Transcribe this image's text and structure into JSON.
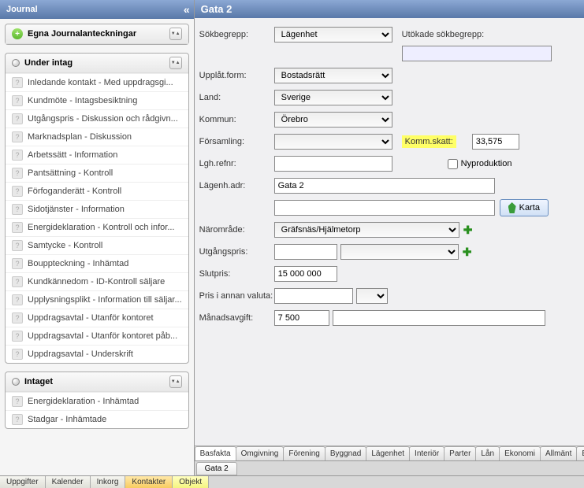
{
  "sidebar": {
    "title": "Journal",
    "sections": [
      {
        "icon": "plus",
        "title": "Egna Journalanteckningar",
        "items": []
      },
      {
        "icon": "bullet",
        "title": "Under intag",
        "items": [
          "Inledande kontakt - Med uppdragsgi...",
          "Kundmöte - Intagsbesiktning",
          "Utgångspris - Diskussion och rådgivn...",
          "Marknadsplan - Diskussion",
          "Arbetssätt - Information",
          "Pantsättning - Kontroll",
          "Förfoganderätt - Kontroll",
          "Sidotjänster - Information",
          "Energideklaration - Kontroll och infor...",
          "Samtycke - Kontroll",
          "Bouppteckning - Inhämtad",
          "Kundkännedom - ID-Kontroll säljare",
          "Upplysningsplikt - Information till säljar...",
          "Uppdragsavtal - Utanför kontoret",
          "Uppdragsavtal - Utanför kontoret påb...",
          "Uppdragsavtal - Underskrift"
        ]
      },
      {
        "icon": "bullet",
        "title": "Intaget",
        "items": [
          "Energideklaration - Inhämtad",
          "Stadgar - Inhämtade"
        ]
      }
    ]
  },
  "content": {
    "title": "Gata 2",
    "form": {
      "sokbegrepp": {
        "label": "Sökbegrepp:",
        "value": "Lägenhet",
        "extra_label": "Utökade sökbegrepp:"
      },
      "upplatform": {
        "label": "Upplåt.form:",
        "value": "Bostadsrätt"
      },
      "land": {
        "label": "Land:",
        "value": "Sverige"
      },
      "kommun": {
        "label": "Kommun:",
        "value": "Örebro"
      },
      "forsamling": {
        "label": "Församling:",
        "value": "",
        "skatt_label": "Komm.skatt:",
        "skatt_value": "33,575"
      },
      "lghrefnr": {
        "label": "Lgh.refnr:",
        "value": "",
        "checkbox_label": "Nyproduktion"
      },
      "lagenhadr": {
        "label": "Lägenh.adr:",
        "value": "Gata 2"
      },
      "karta_button": "Karta",
      "naromrade": {
        "label": "Närområde:",
        "value": "Gräfsnäs/Hjälmetorp"
      },
      "utgangspris": {
        "label": "Utgångspris:",
        "value": ""
      },
      "slutpris": {
        "label": "Slutpris:",
        "value": "15 000 000"
      },
      "prisannan": {
        "label": "Pris i annan valuta:",
        "value": ""
      },
      "manadsavgift": {
        "label": "Månadsavgift:",
        "value": "7 500"
      }
    },
    "tabs": [
      "Basfakta",
      "Omgivning",
      "Förening",
      "Byggnad",
      "Lägenhet",
      "Interiör",
      "Parter",
      "Lån",
      "Ekonomi",
      "Allmänt",
      "Bil"
    ],
    "active_tab": "Basfakta",
    "bottom_tab": "Gata 2"
  },
  "bottom_tabs": {
    "items": [
      "Uppgifter",
      "Kalender",
      "Inkorg",
      "Kontakter",
      "Objekt"
    ],
    "highlights": {
      "Kontakter": "orange",
      "Objekt": "yellow"
    }
  }
}
